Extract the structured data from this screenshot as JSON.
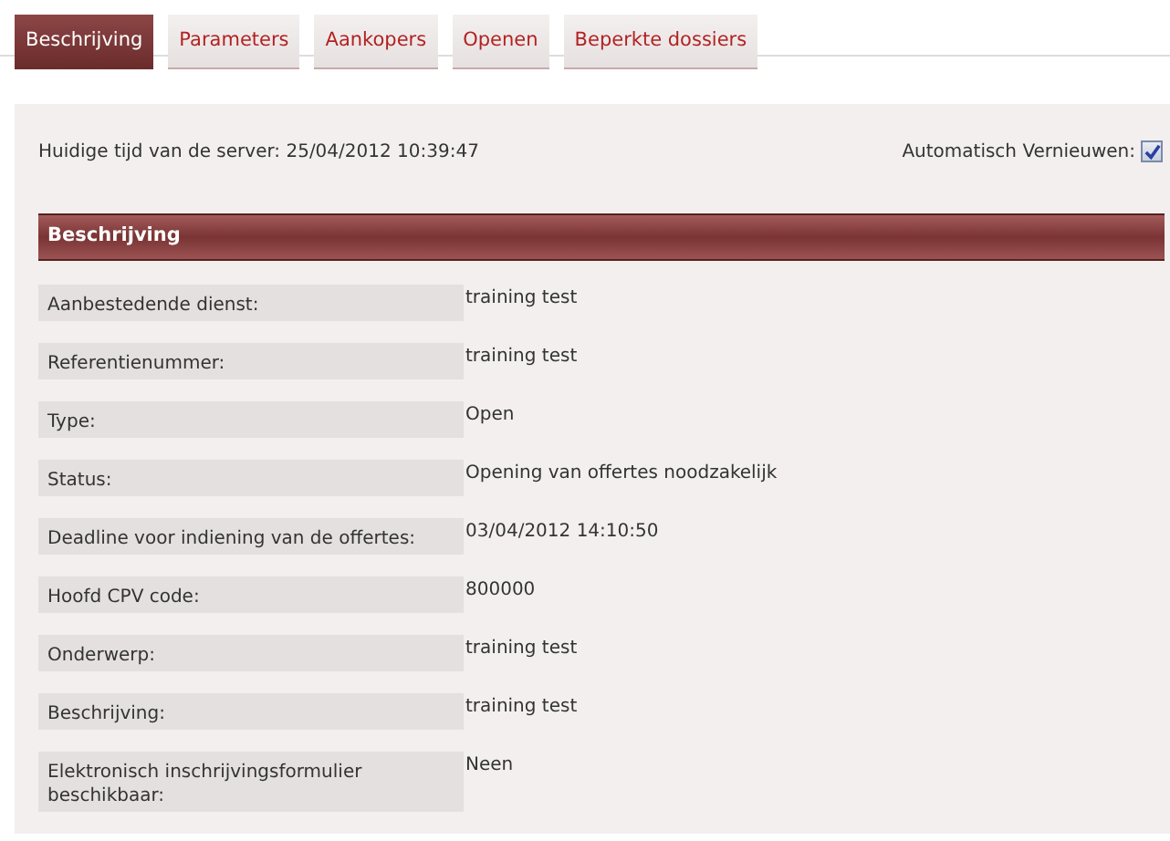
{
  "tabs": [
    {
      "label": "Beschrijving",
      "selected": true
    },
    {
      "label": "Parameters",
      "selected": false
    },
    {
      "label": "Aankopers",
      "selected": false
    },
    {
      "label": "Openen",
      "selected": false
    },
    {
      "label": "Beperkte dossiers",
      "selected": false
    }
  ],
  "server_time": "Huidige tijd van de server: 25/04/2012 10:39:47",
  "auto_refresh": {
    "label": "Automatisch Vernieuwen:",
    "checked": true
  },
  "section": {
    "title": "Beschrijving",
    "rows": [
      {
        "label": "Aanbestedende dienst:",
        "value": "training test"
      },
      {
        "label": "Referentienummer:",
        "value": "training test"
      },
      {
        "label": "Type:",
        "value": "Open"
      },
      {
        "label": "Status:",
        "value": "Opening van offertes noodzakelijk"
      },
      {
        "label": "Deadline voor indiening van de offertes:",
        "value": "03/04/2012 14:10:50"
      },
      {
        "label": "Hoofd CPV code:",
        "value": "800000"
      },
      {
        "label": "Onderwerp:",
        "value": "training test"
      },
      {
        "label": "Beschrijving:",
        "value": "training test"
      },
      {
        "label": "Elektronisch inschrijvingsformulier beschikbaar:",
        "value": "Neen"
      }
    ]
  }
}
